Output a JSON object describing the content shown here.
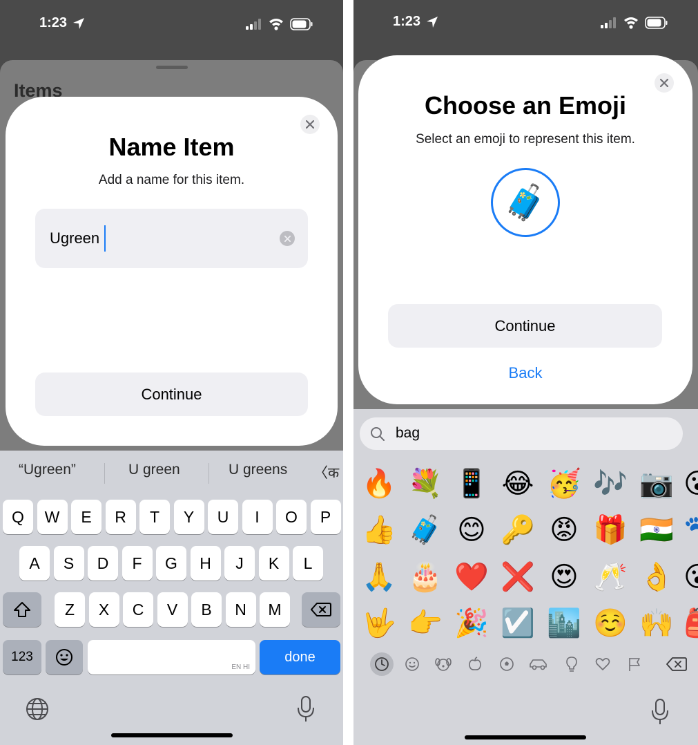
{
  "left_screen": {
    "status": {
      "time": "1:23"
    },
    "background_title": "Items",
    "dialog": {
      "title": "Name Item",
      "subtitle": "Add a name for this item.",
      "input_value": "Ugreen",
      "continue_label": "Continue"
    },
    "keyboard": {
      "suggestions": [
        "“Ugreen”",
        "U green",
        "U greens",
        "〈क"
      ],
      "row1": [
        "Q",
        "W",
        "E",
        "R",
        "T",
        "Y",
        "U",
        "I",
        "O",
        "P"
      ],
      "row2": [
        "A",
        "S",
        "D",
        "F",
        "G",
        "H",
        "J",
        "K",
        "L"
      ],
      "row3": [
        "Z",
        "X",
        "C",
        "V",
        "B",
        "N",
        "M"
      ],
      "numbers_label": "123",
      "space_lang_label": "EN HI",
      "done_label": "done"
    }
  },
  "right_screen": {
    "status": {
      "time": "1:23"
    },
    "dialog": {
      "title": "Choose an Emoji",
      "subtitle": "Select an emoji to represent this item.",
      "selected_emoji": "🧳",
      "continue_label": "Continue",
      "back_label": "Back"
    },
    "emoji_keyboard": {
      "search_query": "bag",
      "emoji_rows": [
        [
          "🔥",
          "💐",
          "📱",
          "😂",
          "🥳",
          "🎶",
          "📷",
          "😮"
        ],
        [
          "👍",
          "🧳",
          "😊",
          "🔑",
          "😡",
          "🎁",
          "🇮🇳",
          "🐾"
        ],
        [
          "🙏",
          "🎂",
          "❤️",
          "❌",
          "😍",
          "🥂",
          "👌",
          "😮"
        ],
        [
          "🤟",
          "👉",
          "🎉",
          "☑️",
          "🏙️",
          "☺️",
          "🙌",
          "🎒"
        ]
      ],
      "categories": [
        "recent-icon",
        "smiley-icon",
        "animal-icon",
        "food-icon",
        "sports-icon",
        "car-icon",
        "bulb-icon",
        "heart-icon",
        "flag-icon",
        "delete-icon"
      ]
    }
  },
  "colors": {
    "accent": "#1a7cf6",
    "dialog_bg": "#ffffff",
    "field_bg": "#efeff3",
    "dim_bg": "#4a4a4a"
  }
}
